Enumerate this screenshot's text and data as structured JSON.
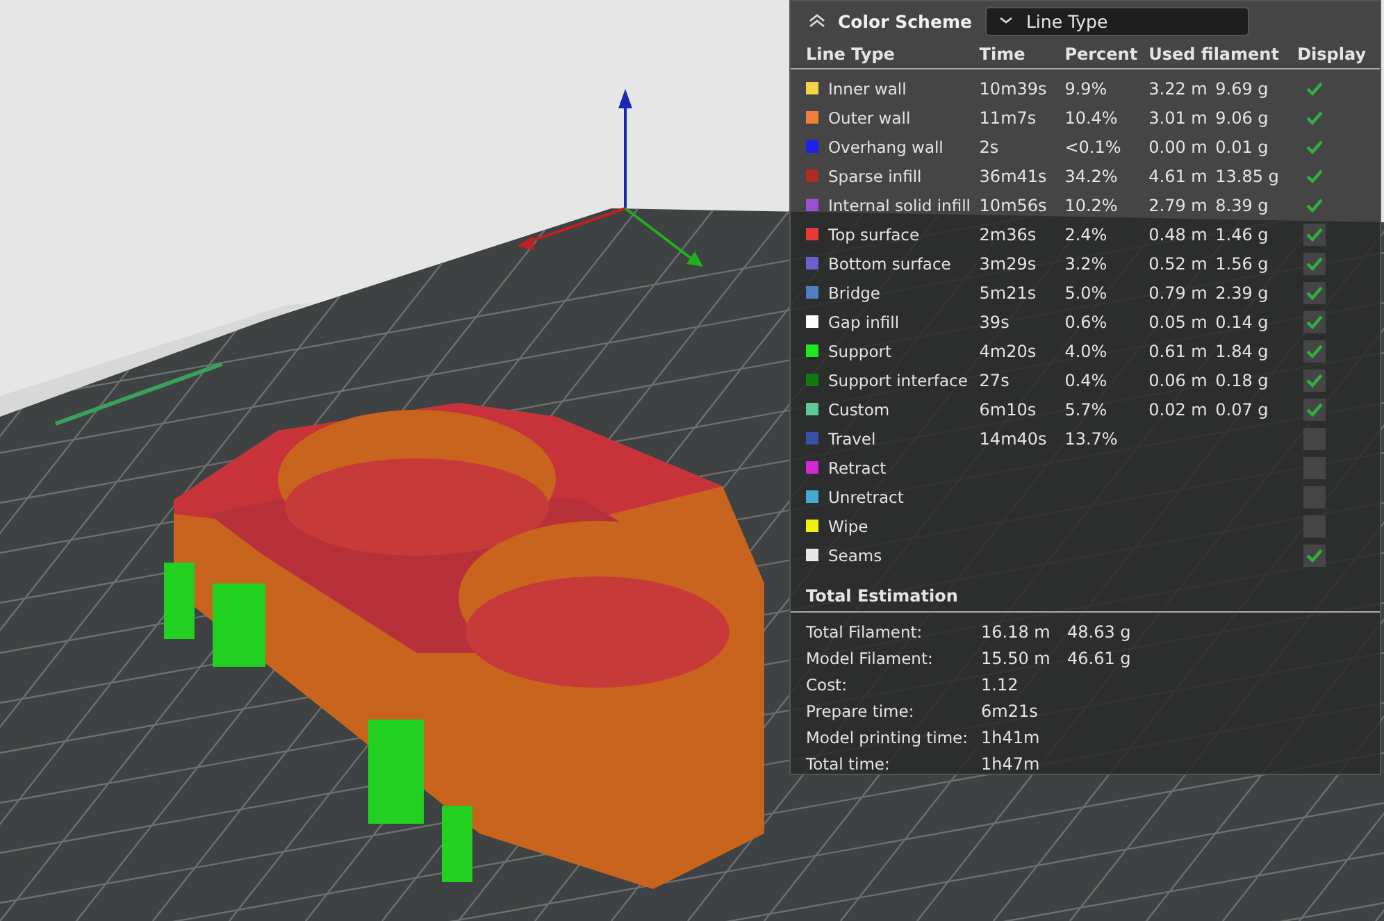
{
  "color_scheme": {
    "title": "Color Scheme",
    "value": "Line Type"
  },
  "columns": [
    "Line Type",
    "Time",
    "Percent",
    "Used filament",
    "Display"
  ],
  "rows": [
    {
      "name": "Inner wall",
      "color": "#f5d547",
      "time": "10m39s",
      "percent": "9.9%",
      "length": "3.22 m",
      "weight": "9.69 g",
      "display": true
    },
    {
      "name": "Outer wall",
      "color": "#f07f3c",
      "time": "11m7s",
      "percent": "10.4%",
      "length": "3.01 m",
      "weight": "9.06 g",
      "display": true
    },
    {
      "name": "Overhang wall",
      "color": "#1f1ff0",
      "time": "2s",
      "percent": "<0.1%",
      "length": "0.00 m",
      "weight": "0.01 g",
      "display": true
    },
    {
      "name": "Sparse infill",
      "color": "#b02a2a",
      "time": "36m41s",
      "percent": "34.2%",
      "length": "4.61 m",
      "weight": "13.85 g",
      "display": true
    },
    {
      "name": "Internal solid infill",
      "color": "#9a4fd0",
      "time": "10m56s",
      "percent": "10.2%",
      "length": "2.79 m",
      "weight": "8.39 g",
      "display": true
    },
    {
      "name": "Top surface",
      "color": "#e83a3a",
      "time": "2m36s",
      "percent": "2.4%",
      "length": "0.48 m",
      "weight": "1.46 g",
      "display": true
    },
    {
      "name": "Bottom surface",
      "color": "#6b5fd0",
      "time": "3m29s",
      "percent": "3.2%",
      "length": "0.52 m",
      "weight": "1.56 g",
      "display": true
    },
    {
      "name": "Bridge",
      "color": "#4f7fc0",
      "time": "5m21s",
      "percent": "5.0%",
      "length": "0.79 m",
      "weight": "2.39 g",
      "display": true
    },
    {
      "name": "Gap infill",
      "color": "#ffffff",
      "time": "39s",
      "percent": "0.6%",
      "length": "0.05 m",
      "weight": "0.14 g",
      "display": true
    },
    {
      "name": "Support",
      "color": "#1ee81e",
      "time": "4m20s",
      "percent": "4.0%",
      "length": "0.61 m",
      "weight": "1.84 g",
      "display": true
    },
    {
      "name": "Support interface",
      "color": "#107a10",
      "time": "27s",
      "percent": "0.4%",
      "length": "0.06 m",
      "weight": "0.18 g",
      "display": true
    },
    {
      "name": "Custom",
      "color": "#5ec796",
      "time": "6m10s",
      "percent": "5.7%",
      "length": "0.02 m",
      "weight": "0.07 g",
      "display": true
    },
    {
      "name": "Travel",
      "color": "#3a4fa8",
      "time": "14m40s",
      "percent": "13.7%",
      "display": false
    },
    {
      "name": "Retract",
      "color": "#d02ad0",
      "display": false
    },
    {
      "name": "Unretract",
      "color": "#44aad0",
      "display": false
    },
    {
      "name": "Wipe",
      "color": "#f0f010",
      "display": false
    },
    {
      "name": "Seams",
      "color": "#e8e8e8",
      "display": true
    }
  ],
  "total_estimation": {
    "title": "Total Estimation",
    "items": [
      {
        "label": "Total Filament:",
        "values": [
          "16.18 m",
          "48.63 g"
        ]
      },
      {
        "label": "Model Filament:",
        "values": [
          "15.50 m",
          "46.61 g"
        ]
      },
      {
        "label": "Cost:",
        "values": [
          "1.12"
        ]
      },
      {
        "label": "Prepare time:",
        "values": [
          "6m21s"
        ]
      },
      {
        "label": "Model printing time:",
        "values": [
          "1h41m"
        ]
      },
      {
        "label": "Total time:",
        "values": [
          "1h47m"
        ]
      }
    ]
  }
}
